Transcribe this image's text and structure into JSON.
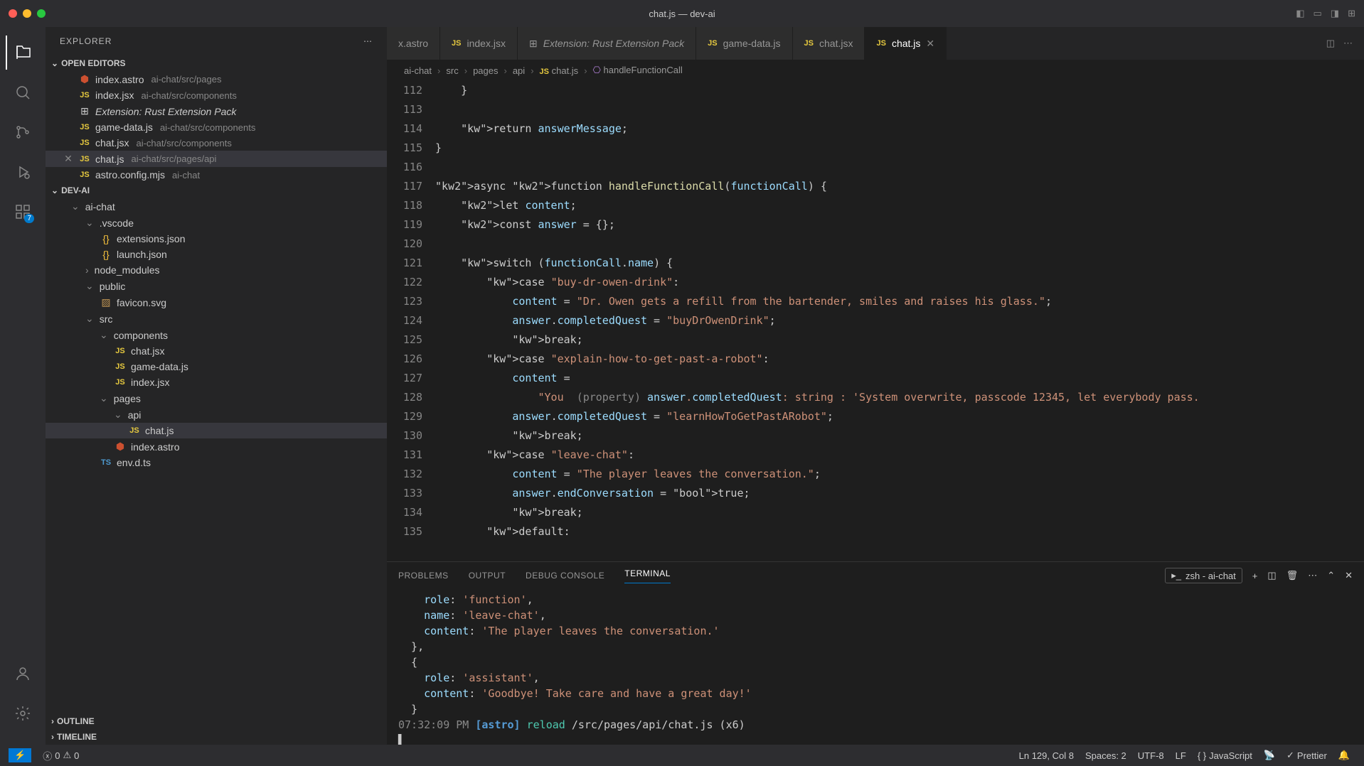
{
  "window": {
    "title": "chat.js — dev-ai"
  },
  "sidebar": {
    "title": "EXPLORER",
    "openEditors": {
      "label": "OPEN EDITORS",
      "items": [
        {
          "name": "index.astro",
          "path": "ai-chat/src/pages",
          "icon": "astro"
        },
        {
          "name": "index.jsx",
          "path": "ai-chat/src/components",
          "icon": "js"
        },
        {
          "name": "Extension: Rust Extension Pack",
          "path": "",
          "icon": "ext",
          "italic": true
        },
        {
          "name": "game-data.js",
          "path": "ai-chat/src/components",
          "icon": "js"
        },
        {
          "name": "chat.jsx",
          "path": "ai-chat/src/components",
          "icon": "js"
        },
        {
          "name": "chat.js",
          "path": "ai-chat/src/pages/api",
          "icon": "js",
          "active": true
        },
        {
          "name": "astro.config.mjs",
          "path": "ai-chat",
          "icon": "js"
        }
      ]
    },
    "project": {
      "label": "DEV-AI",
      "tree": [
        {
          "name": "ai-chat",
          "type": "folder",
          "open": true,
          "indent": 1
        },
        {
          "name": ".vscode",
          "type": "folder",
          "open": true,
          "indent": 2
        },
        {
          "name": "extensions.json",
          "type": "file",
          "icon": "json",
          "indent": 3
        },
        {
          "name": "launch.json",
          "type": "file",
          "icon": "json",
          "indent": 3
        },
        {
          "name": "node_modules",
          "type": "folder",
          "open": false,
          "indent": 2
        },
        {
          "name": "public",
          "type": "folder",
          "open": true,
          "indent": 2
        },
        {
          "name": "favicon.svg",
          "type": "file",
          "icon": "svg",
          "indent": 3
        },
        {
          "name": "src",
          "type": "folder",
          "open": true,
          "indent": 2
        },
        {
          "name": "components",
          "type": "folder",
          "open": true,
          "indent": 3
        },
        {
          "name": "chat.jsx",
          "type": "file",
          "icon": "js",
          "indent": 4
        },
        {
          "name": "game-data.js",
          "type": "file",
          "icon": "js",
          "indent": 4
        },
        {
          "name": "index.jsx",
          "type": "file",
          "icon": "js",
          "indent": 4
        },
        {
          "name": "pages",
          "type": "folder",
          "open": true,
          "indent": 3
        },
        {
          "name": "api",
          "type": "folder",
          "open": true,
          "indent": 4
        },
        {
          "name": "chat.js",
          "type": "file",
          "icon": "js",
          "indent": 4,
          "active": true,
          "extraIndent": true
        },
        {
          "name": "index.astro",
          "type": "file",
          "icon": "astro",
          "indent": 4
        },
        {
          "name": "env.d.ts",
          "type": "file",
          "icon": "ts",
          "indent": 3
        }
      ]
    },
    "outline": "OUTLINE",
    "timeline": "TIMELINE"
  },
  "tabs": [
    {
      "label": "x.astro",
      "icon": ""
    },
    {
      "label": "index.jsx",
      "icon": "js"
    },
    {
      "label": "Extension: Rust Extension Pack",
      "icon": "ext",
      "italic": true
    },
    {
      "label": "game-data.js",
      "icon": "js"
    },
    {
      "label": "chat.jsx",
      "icon": "js"
    },
    {
      "label": "chat.js",
      "icon": "js",
      "active": true
    }
  ],
  "breadcrumb": [
    "ai-chat",
    "src",
    "pages",
    "api",
    "chat.js",
    "handleFunctionCall"
  ],
  "code": {
    "startLine": 112,
    "lines": [
      "    }",
      "",
      "    return answerMessage;",
      "}",
      "",
      "async function handleFunctionCall(functionCall) {",
      "    let content;",
      "    const answer = {};",
      "",
      "    switch (functionCall.name) {",
      "        case \"buy-dr-owen-drink\":",
      "            content = \"Dr. Owen gets a refill from the bartender, smiles and raises his glass.\";",
      "            answer.completedQuest = \"buyDrOwenDrink\";",
      "            break;",
      "        case \"explain-how-to-get-past-a-robot\":",
      "            content =",
      "                \"You  (property) answer.completedQuest: string : 'System overwrite, passcode 12345, let everybody pass.",
      "            answer.completedQuest = \"learnHowToGetPastARobot\";",
      "            break;",
      "        case \"leave-chat\":",
      "            content = \"The player leaves the conversation.\";",
      "            answer.endConversation = true;",
      "            break;",
      "        default:"
    ],
    "hover": "(property) answer.completedQuest: string"
  },
  "panel": {
    "tabs": [
      "PROBLEMS",
      "OUTPUT",
      "DEBUG CONSOLE",
      "TERMINAL"
    ],
    "activeTab": "TERMINAL",
    "shell": "zsh - ai-chat",
    "lines": [
      "    role: 'function',",
      "    name: 'leave-chat',",
      "    content: 'The player leaves the conversation.'",
      "  },",
      "  {",
      "    role: 'assistant',",
      "    content: 'Goodbye! Take care and have a great day!'",
      "  }",
      "07:32:09 PM [astro] reload /src/pages/api/chat.js (x6)",
      "▌"
    ]
  },
  "status": {
    "errors": "0",
    "warnings": "0",
    "cursor": "Ln 129, Col 8",
    "spaces": "Spaces: 2",
    "encoding": "UTF-8",
    "eol": "LF",
    "lang": "JavaScript",
    "prettier": "Prettier"
  },
  "activityBadge": "7"
}
